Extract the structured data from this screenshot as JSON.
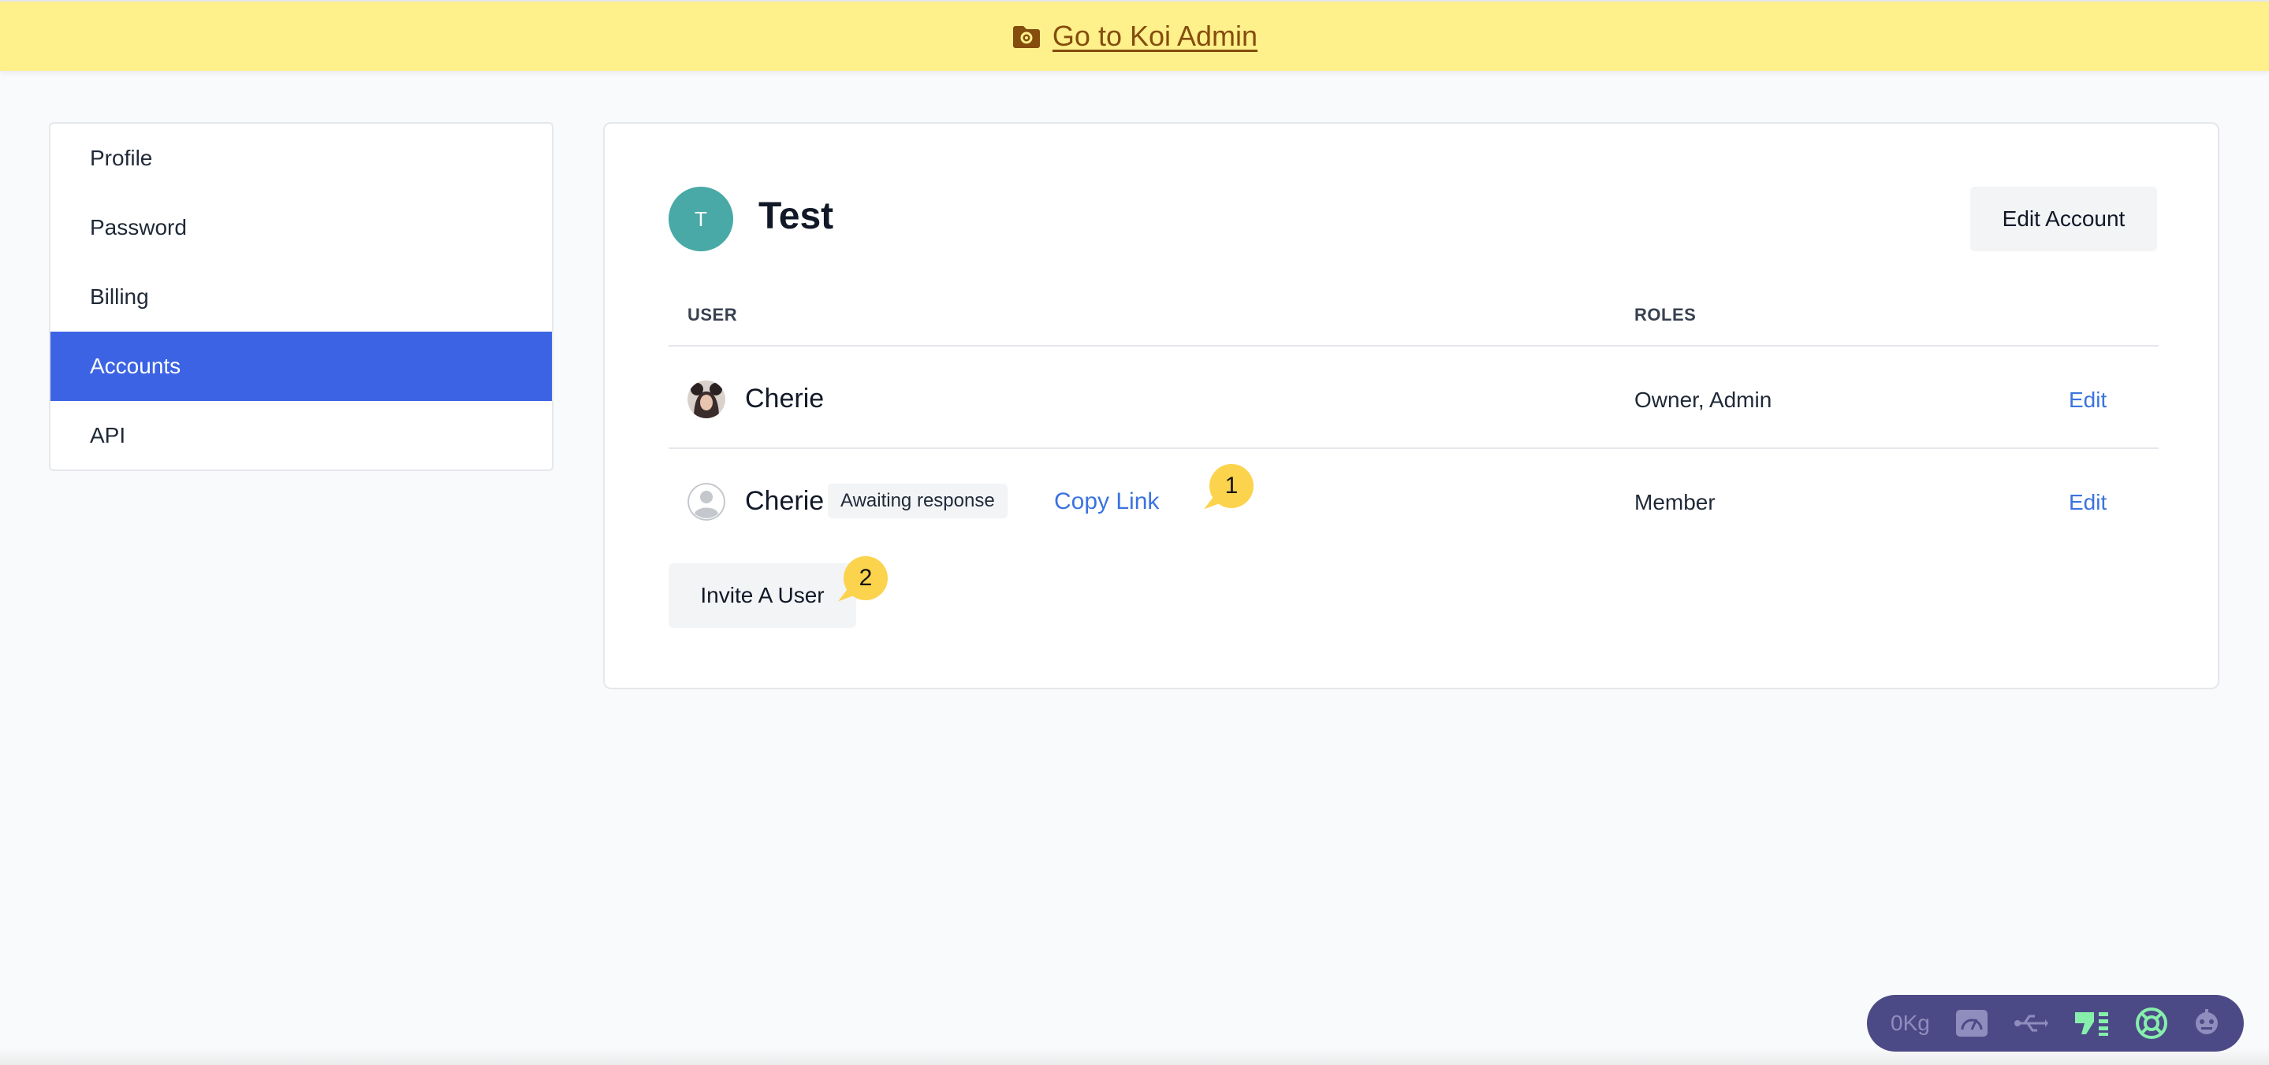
{
  "banner": {
    "link_text": "Go to Koi Admin",
    "color": "#fef08a",
    "icon": "folder-gear-icon"
  },
  "sidebar": {
    "items": [
      {
        "label": "Profile",
        "active": false
      },
      {
        "label": "Password",
        "active": false
      },
      {
        "label": "Billing",
        "active": false
      },
      {
        "label": "Accounts",
        "active": true
      },
      {
        "label": "API",
        "active": false
      }
    ],
    "active_color": "#3b63e3"
  },
  "account": {
    "avatar_initial": "T",
    "name": "Test",
    "edit_button": "Edit Account"
  },
  "table": {
    "headers": {
      "user": "USER",
      "roles": "ROLES"
    },
    "rows": [
      {
        "name": "Cherie",
        "roles": "Owner, Admin",
        "action": "Edit",
        "avatar": "photo-avatar"
      },
      {
        "name": "Cherie",
        "badge": "Awaiting response",
        "copy_link": "Copy Link",
        "roles": "Member",
        "action": "Edit",
        "avatar": "default-user-avatar"
      }
    ]
  },
  "invite_button": "Invite A User",
  "markers": [
    "1",
    "2"
  ],
  "toolbar": {
    "weight": "0Kg",
    "icons": [
      "speedometer-icon",
      "usb-icon",
      "signal-bars-icon",
      "lifebuoy-icon",
      "robot-icon"
    ]
  }
}
